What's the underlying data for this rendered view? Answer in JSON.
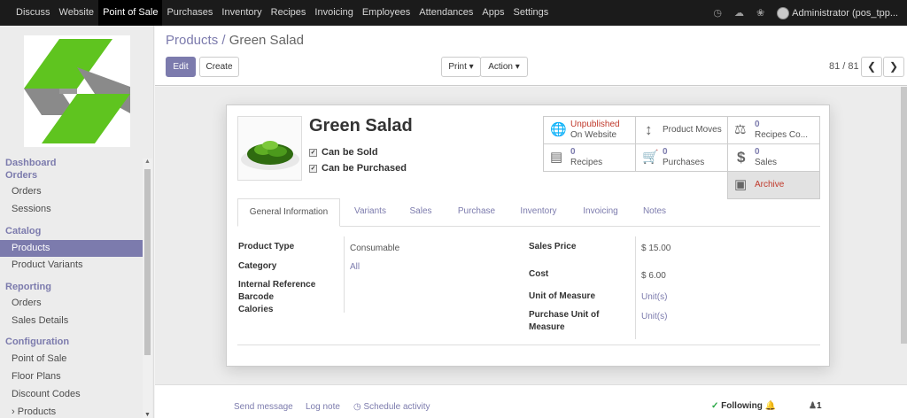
{
  "topmenu": {
    "items": [
      "Discuss",
      "Website",
      "Point of Sale",
      "Purchases",
      "Inventory",
      "Recipes",
      "Invoicing",
      "Employees",
      "Attendances",
      "Apps",
      "Settings"
    ],
    "active": "Point of Sale",
    "user": "Administrator (pos_tpp..."
  },
  "sidebar": {
    "dashboard": "Dashboard",
    "orders_head": "Orders",
    "orders": "Orders",
    "sessions": "Sessions",
    "catalog": "Catalog",
    "products": "Products",
    "product_variants": "Product Variants",
    "reporting": "Reporting",
    "rep_orders": "Orders",
    "sales_details": "Sales Details",
    "configuration": "Configuration",
    "point_of_sale": "Point of Sale",
    "floor_plans": "Floor Plans",
    "discount_codes": "Discount Codes",
    "cfg_products": "Products"
  },
  "breadcrumb": {
    "parent": "Products /",
    "current": "Green Salad"
  },
  "buttons": {
    "edit": "Edit",
    "create": "Create",
    "print": "Print ▾",
    "action": "Action ▾"
  },
  "pager": {
    "value": "81 / 81"
  },
  "product": {
    "name": "Green Salad",
    "can_be_sold": "Can be Sold",
    "can_be_purchased": "Can be Purchased"
  },
  "smart_buttons": {
    "website_status": "Unpublished",
    "website_sub": "On Website",
    "product_moves": "Product Moves",
    "recipes_co_count": "0",
    "recipes_co_label": "Recipes Co...",
    "recipes_count": "0",
    "recipes_label": "Recipes",
    "purchases_count": "0",
    "purchases_label": "Purchases",
    "sales_count": "0",
    "sales_label": "Sales",
    "archive": "Archive"
  },
  "tabs": [
    "General Information",
    "Variants",
    "Sales",
    "Purchase",
    "Inventory",
    "Invoicing",
    "Notes"
  ],
  "fields": {
    "product_type_label": "Product Type",
    "product_type": "Consumable",
    "category_label": "Category",
    "category": "All",
    "internal_ref_label": "Internal Reference",
    "barcode_label": "Barcode",
    "calories_label": "Calories",
    "sales_price_label": "Sales Price",
    "sales_price": "$ 15.00",
    "cost_label": "Cost",
    "cost": "$ 6.00",
    "uom_label": "Unit of Measure",
    "uom": "Unit(s)",
    "purchase_uom_label_1": "Purchase Unit of",
    "purchase_uom_label_2": "Measure",
    "purchase_uom": "Unit(s)"
  },
  "chatter": {
    "send_message": "Send message",
    "log_note": "Log note",
    "schedule_activity": "Schedule activity",
    "following": "Following",
    "followers": "1"
  },
  "colors": {
    "accent": "#7c7bad",
    "unpublished": "#c0392b",
    "logo_green": "#5fc41f",
    "logo_gray": "#8a8a8a"
  }
}
